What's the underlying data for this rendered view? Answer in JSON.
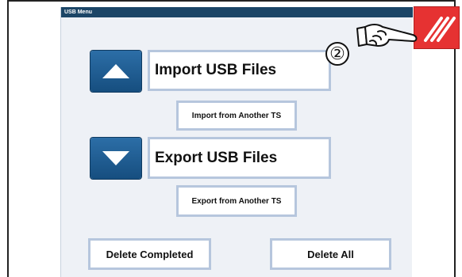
{
  "window": {
    "title": "USB Menu"
  },
  "import": {
    "label": "Import USB Files",
    "other_label": "Import from Another TS"
  },
  "export": {
    "label": "Export USB Files",
    "other_label": "Export from Another TS"
  },
  "actions": {
    "delete_completed": "Delete Completed",
    "delete_all": "Delete All"
  },
  "annotation": {
    "step_number": "②"
  },
  "icons": {
    "import_arrow": "triangle-up-icon",
    "export_arrow": "triangle-down-icon",
    "corner_icon": "red-stripes-icon",
    "pointer": "pointing-hand-icon"
  },
  "colors": {
    "title_bar": "#1b4566",
    "arrow_button": "#1f5d94",
    "button_border": "#b6c6dd",
    "screen_bg": "#eef1f6",
    "corner_icon": "#e63232"
  }
}
